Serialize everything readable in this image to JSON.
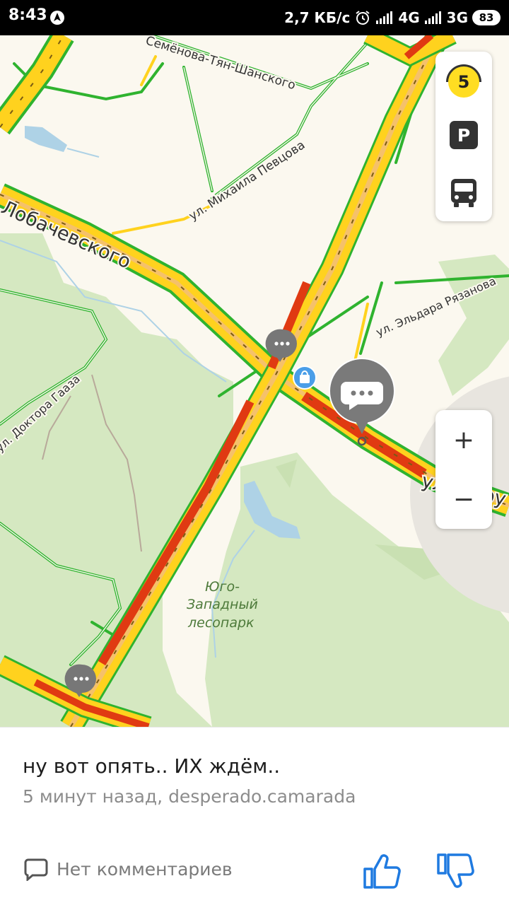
{
  "status_bar": {
    "time": "8:43",
    "network_speed": "2,7 КБ/с",
    "network_4g": "4G",
    "network_3g": "3G",
    "battery": "83"
  },
  "map": {
    "streets": {
      "lobachevsky": "Лобачевского",
      "semenova": "Семёнова-Тян-Шанского",
      "pevtsova": "ул. Михаила Певцова",
      "ryazanova": "ул. Эльдара Рязанова",
      "gaaza": "ул. Доктора Гааза",
      "obruch": "ул. Обру"
    },
    "park_name": [
      "Юго-",
      "Западный",
      "лесопарк"
    ],
    "traffic_score": "5",
    "parking_label": "P",
    "zoom_in": "+",
    "zoom_out": "−",
    "colors": {
      "background": "#fbf8ef",
      "park": "#d5e8c1",
      "water": "#aed2e6",
      "traffic_free": "#2fb32f",
      "traffic_medium": "#ffd21e",
      "traffic_heavy": "#e03a12"
    },
    "icons": [
      "chat-bubble-icon",
      "shopping-bag-icon",
      "bus-icon",
      "traffic-light-icon"
    ]
  },
  "card": {
    "message": "ну вот опять.. ИХ ждём..",
    "meta": "5 минут назад, desperado.camarada",
    "comments_label": "Нет комментариев",
    "accent": "#1f7ae0"
  }
}
